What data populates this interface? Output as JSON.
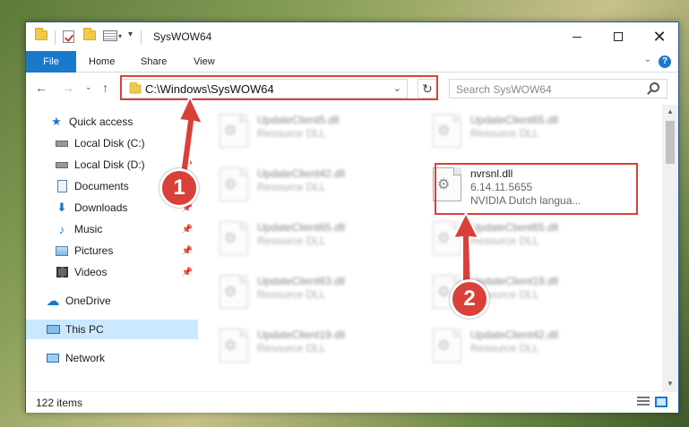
{
  "window": {
    "title": "SysWOW64",
    "ribbon_tabs": [
      "File",
      "Home",
      "Share",
      "View"
    ],
    "help": "?"
  },
  "address": {
    "path": "C:\\Windows\\SysWOW64",
    "search_placeholder": "Search SysWOW64"
  },
  "sidebar": {
    "items": [
      {
        "label": "Quick access",
        "icon": "star-icon",
        "pinned": false
      },
      {
        "label": "Local Disk (C:)",
        "icon": "drive-icon",
        "pinned": true
      },
      {
        "label": "Local Disk (D:)",
        "icon": "drive-icon",
        "pinned": true
      },
      {
        "label": "Documents",
        "icon": "documents-icon",
        "pinned": true
      },
      {
        "label": "Downloads",
        "icon": "downloads-icon",
        "pinned": true
      },
      {
        "label": "Music",
        "icon": "music-icon",
        "pinned": true
      },
      {
        "label": "Pictures",
        "icon": "pictures-icon",
        "pinned": true
      },
      {
        "label": "Videos",
        "icon": "videos-icon",
        "pinned": true
      },
      {
        "label": "OneDrive",
        "icon": "cloud-icon",
        "pinned": false
      },
      {
        "label": "This PC",
        "icon": "computer-icon",
        "pinned": false,
        "selected": true
      },
      {
        "label": "Network",
        "icon": "network-icon",
        "pinned": false
      }
    ]
  },
  "files": [
    {
      "name": "UpdateClient5.dll",
      "sub": "Resource DLL",
      "blurred": true
    },
    {
      "name": "UpdateClient65.dll",
      "sub": "Resource DLL",
      "blurred": true
    },
    {
      "name": "UpdateClient42.dll",
      "sub": "Resource DLL",
      "blurred": true
    },
    {
      "name": "nvrsnl.dll",
      "sub": "6.14.11.5655",
      "sub2": "NVIDIA Dutch langua...",
      "blurred": false
    },
    {
      "name": "UpdateClient65.dll",
      "sub": "Resource DLL",
      "blurred": true
    },
    {
      "name": "UpdateClient65.dll",
      "sub": "Resource DLL",
      "blurred": true
    },
    {
      "name": "UpdateClient63.dll",
      "sub": "Resource DLL",
      "blurred": true
    },
    {
      "name": "UpdateClient19.dll",
      "sub": "Resource DLL",
      "blurred": true
    },
    {
      "name": "UpdateClient19.dll",
      "sub": "Resource DLL",
      "blurred": true
    },
    {
      "name": "UpdateClient42.dll",
      "sub": "Resource DLL",
      "blurred": true
    }
  ],
  "status": {
    "item_count": "122 items"
  },
  "annotations": {
    "badge1": "1",
    "badge2": "2",
    "highlight_color": "#d9403a"
  }
}
